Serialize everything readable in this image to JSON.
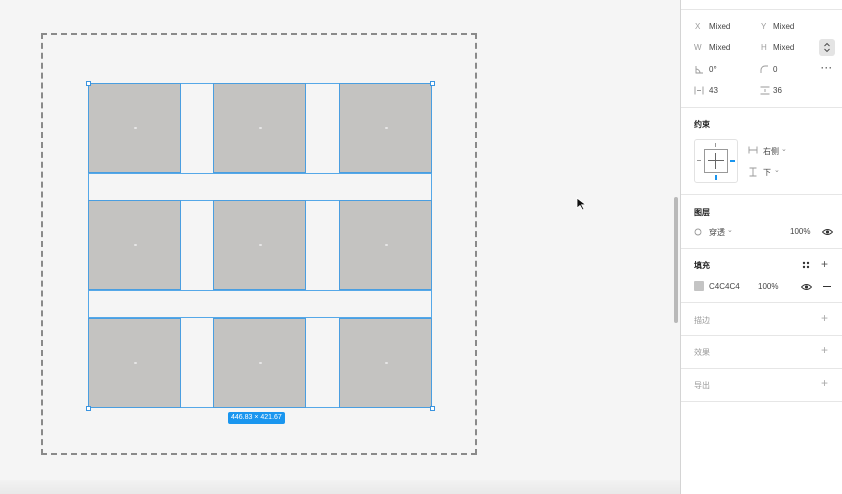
{
  "canvas": {
    "selection_size": "446.83 × 421.67"
  },
  "properties": {
    "x_label": "X",
    "x_value": "Mixed",
    "y_label": "Y",
    "y_value": "Mixed",
    "w_label": "W",
    "w_value": "Mixed",
    "h_label": "H",
    "h_value": "Mixed",
    "rotation": "0°",
    "radius": "0",
    "h_spacing": "43",
    "v_spacing": "36"
  },
  "constraints": {
    "title": "约束",
    "horizontal": "右侧",
    "vertical": "下"
  },
  "layer": {
    "title": "图层",
    "blend_mode": "穿透",
    "opacity": "100%"
  },
  "fill": {
    "title": "填充",
    "hex": "C4C4C4",
    "opacity": "100%",
    "color": "#c4c4c4"
  },
  "sections": {
    "stroke": "描边",
    "effects": "效果",
    "export": "导出"
  },
  "colors": {
    "selection": "#4a9ee0",
    "badge": "#1a96ef",
    "placeholder": "#c4c3c1"
  }
}
